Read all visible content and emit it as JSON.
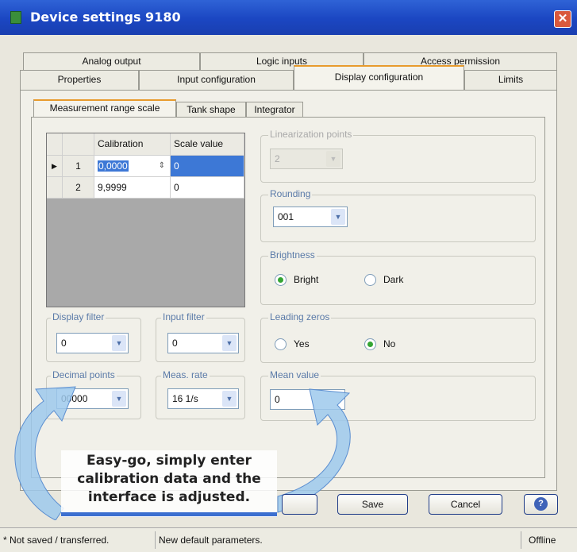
{
  "window": {
    "title": "Device settings 9180",
    "close_glyph": "✕"
  },
  "tabs_row1": [
    "Analog output",
    "Logic inputs",
    "Access permission"
  ],
  "tabs_row2": [
    "Properties",
    "Input configuration",
    "Display configuration",
    "Limits"
  ],
  "subtabs": [
    "Measurement range scale",
    "Tank shape",
    "Integrator"
  ],
  "grid": {
    "headers": [
      "Calibration",
      "Scale value"
    ],
    "rows": [
      {
        "index": "1",
        "calibration": "0,0000",
        "scale": "0"
      },
      {
        "index": "2",
        "calibration": "9,9999",
        "scale": "0"
      }
    ]
  },
  "linearization": {
    "label": "Linearization points",
    "value": "2"
  },
  "rounding": {
    "label": "Rounding",
    "value": "001"
  },
  "brightness": {
    "label": "Brightness",
    "options": [
      "Bright",
      "Dark"
    ],
    "selected": "Bright"
  },
  "display_filter": {
    "label": "Display filter",
    "value": "0"
  },
  "input_filter": {
    "label": "Input filter",
    "value": "0"
  },
  "leading_zeros": {
    "label": "Leading zeros",
    "options": [
      "Yes",
      "No"
    ],
    "selected": "No"
  },
  "decimal_points": {
    "label": "Decimal points",
    "value": "00000"
  },
  "meas_rate": {
    "label": "Meas. rate",
    "value": "16 1/s"
  },
  "mean_value": {
    "label": "Mean value",
    "value": "0"
  },
  "buttons": {
    "save": "Save",
    "cancel": "Cancel",
    "help": "?"
  },
  "status": {
    "left": "* Not saved / transferred.",
    "middle": "New default parameters.",
    "right": "Offline"
  },
  "callout": {
    "text": "Easy-go, simply enter calibration data and the interface is adjusted."
  },
  "colors": {
    "title_bar": "#1f4bc4",
    "accent_tab": "#e89b2d",
    "selection": "#3d78d6",
    "arrow": "#8fc0e8"
  },
  "icons": {
    "close": "close-icon",
    "help": "help-icon",
    "app": "app-icon",
    "dropdown": "chevron-down-icon",
    "spin": "spin-icon",
    "row_pointer": "row-pointer-icon"
  }
}
